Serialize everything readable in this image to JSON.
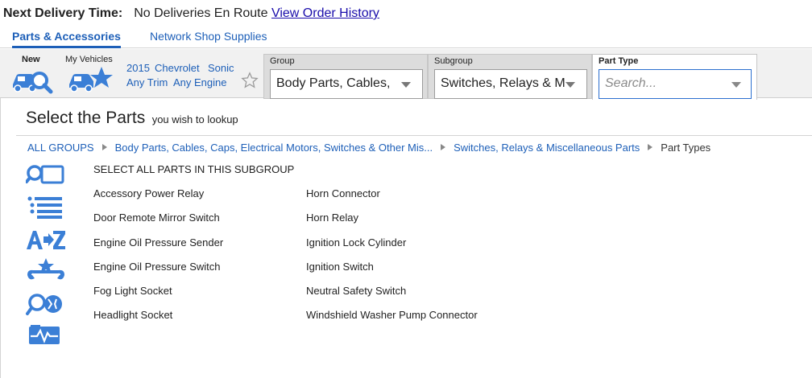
{
  "delivery": {
    "label": "Next Delivery Time:",
    "status": "No Deliveries En Route",
    "history_link": "View Order History"
  },
  "tabs": [
    {
      "label": "Parts & Accessories",
      "active": true
    },
    {
      "label": "Network Shop Supplies",
      "active": false
    }
  ],
  "vehicle_bar": {
    "new_label": "New",
    "my_vehicles_label": "My Vehicles",
    "year": "2015",
    "make": "Chevrolet",
    "model": "Sonic",
    "trim": "Any Trim",
    "engine": "Any Engine"
  },
  "selectors": {
    "group": {
      "header": "Group",
      "value": "Body Parts, Cables,"
    },
    "subgroup": {
      "header": "Subgroup",
      "value": "Switches, Relays & M"
    },
    "part_type": {
      "header": "Part Type",
      "placeholder": "Search..."
    }
  },
  "page": {
    "title": "Select the Parts",
    "subtitle": "you wish to lookup"
  },
  "breadcrumb": {
    "items": [
      "ALL GROUPS",
      "Body Parts, Cables, Caps, Electrical Motors, Switches & Other Mis...",
      "Switches, Relays & Miscellaneous Parts"
    ],
    "current": "Part Types"
  },
  "side_icons": [
    "search-parts-icon",
    "list-icon",
    "a-to-z-icon",
    "tools-star-icon",
    "diagnostic-search-icon",
    "vehicle-pulse-icon"
  ],
  "select_all": "SELECT ALL PARTS IN THIS SUBGROUP",
  "parts_col1": [
    "Accessory Power Relay",
    "Door Remote Mirror Switch",
    "Engine Oil Pressure Sender",
    "Engine Oil Pressure Switch",
    "Fog Light Socket",
    "Headlight Socket"
  ],
  "parts_col2": [
    "Horn Connector",
    "Horn Relay",
    "Ignition Lock Cylinder",
    "Ignition Switch",
    "Neutral Safety Switch",
    "Windshield Washer Pump Connector"
  ],
  "colors": {
    "link": "#1d5fb8",
    "icon": "#3b7fd6",
    "toolbar_bg": "#f1f1f1"
  }
}
